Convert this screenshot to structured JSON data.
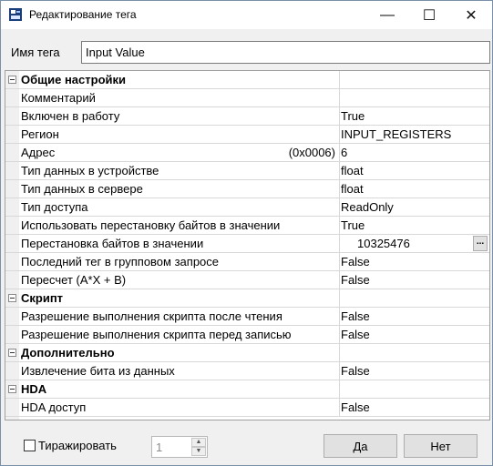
{
  "window": {
    "title": "Редактирование тега",
    "controls": {
      "minimize": "—",
      "maximize": "☐",
      "close": "✕"
    }
  },
  "tag_name": {
    "label": "Имя тега",
    "value": "Input Value"
  },
  "properties": {
    "rows": [
      {
        "kind": "category",
        "name": "Общие настройки",
        "value": ""
      },
      {
        "kind": "prop",
        "name": "Комментарий",
        "value": ""
      },
      {
        "kind": "prop",
        "name": "Включен в работу",
        "value": "True"
      },
      {
        "kind": "prop",
        "name": "Регион",
        "value": "INPUT_REGISTERS"
      },
      {
        "kind": "prop",
        "name": "Адрес",
        "suffix": "(0x0006)",
        "value": "6"
      },
      {
        "kind": "prop",
        "name": "Тип данных в устройстве",
        "value": "float"
      },
      {
        "kind": "prop",
        "name": "Тип данных в сервере",
        "value": "float"
      },
      {
        "kind": "prop",
        "name": "Тип доступа",
        "value": "ReadOnly"
      },
      {
        "kind": "prop",
        "name": "Использовать перестановку байтов в значении",
        "value": "True"
      },
      {
        "kind": "prop",
        "name": "Перестановка байтов в значении",
        "value": "10325476",
        "button": "..."
      },
      {
        "kind": "prop",
        "name": "Последний тег в групповом запросе",
        "value": "False"
      },
      {
        "kind": "prop",
        "name": "Пересчет (A*X + B)",
        "value": "False"
      },
      {
        "kind": "category",
        "name": "Скрипт",
        "value": ""
      },
      {
        "kind": "prop",
        "name": "Разрешение выполнения скрипта после чтения",
        "value": "False"
      },
      {
        "kind": "prop",
        "name": "Разрешение выполнения скрипта перед записью",
        "value": "False"
      },
      {
        "kind": "category",
        "name": "Дополнительно",
        "value": ""
      },
      {
        "kind": "prop",
        "name": "Извлечение бита из данных",
        "value": "False"
      },
      {
        "kind": "category",
        "name": "HDA",
        "value": ""
      },
      {
        "kind": "prop",
        "name": "HDA доступ",
        "value": "False"
      }
    ]
  },
  "footer": {
    "replicate_label": "Тиражировать",
    "replicate_checked": false,
    "count_value": "1",
    "ok_label": "Да",
    "cancel_label": "Нет"
  },
  "icons": {
    "app": "opc-server-icon",
    "expander": "collapse-minus-icon",
    "spin_up": "arrow-up-icon",
    "spin_down": "arrow-down-icon"
  }
}
